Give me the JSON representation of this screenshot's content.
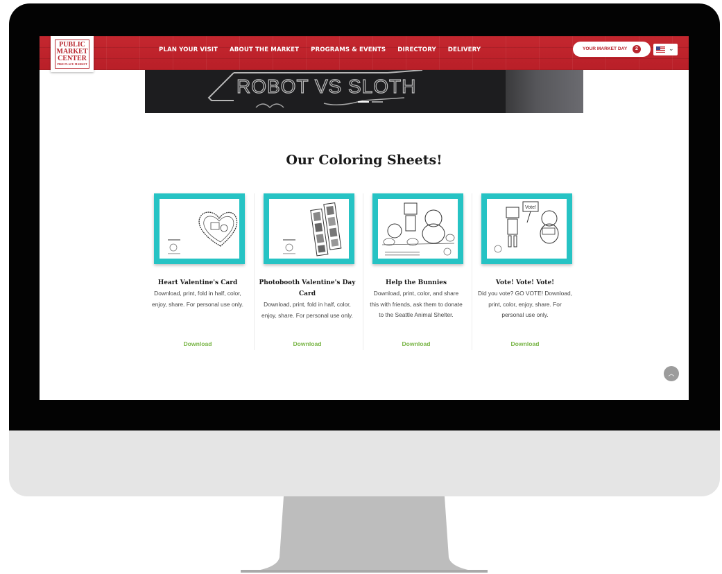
{
  "logo": {
    "line1": "PUBLIC",
    "line2": "MARKET",
    "line3": "CENTER",
    "line4": "PIKE PLACE MARKET"
  },
  "nav": {
    "items": [
      {
        "label": "PLAN YOUR VISIT"
      },
      {
        "label": "ABOUT THE MARKET"
      },
      {
        "label": "PROGRAMS & EVENTS"
      },
      {
        "label": "DIRECTORY"
      },
      {
        "label": "DELIVERY"
      }
    ],
    "market_day_label": "YOUR MARKET DAY",
    "market_day_count": "2",
    "language_flag": "us-flag-icon",
    "brand_color": "#c2262e"
  },
  "hero": {
    "sign_text": "ROBOT VS SLOTH",
    "slides": 2,
    "active_slide": 1
  },
  "section": {
    "title": "Our Coloring Sheets!"
  },
  "cards": [
    {
      "title": "Heart Valentine's Card",
      "description": "Download, print, fold in half, color, enjoy, share. For personal use only.",
      "download": "Download"
    },
    {
      "title": "Photobooth Valentine's Day Card",
      "description": "Download, print, fold in half, color, enjoy, share. For personal use only.",
      "download": "Download"
    },
    {
      "title": "Help the Bunnies",
      "description": "Download, print, color, and share this with friends, ask them to donate to the Seattle Animal Shelter.",
      "download": "Download"
    },
    {
      "title": "Vote! Vote! Vote!",
      "description": "Did you vote? GO VOTE! Download, print, color, enjoy, share. For personal use only.",
      "download": "Download",
      "sign_text": "Vote!"
    }
  ],
  "accent_colors": {
    "teal": "#26c3c4",
    "download_green": "#7ab648"
  }
}
